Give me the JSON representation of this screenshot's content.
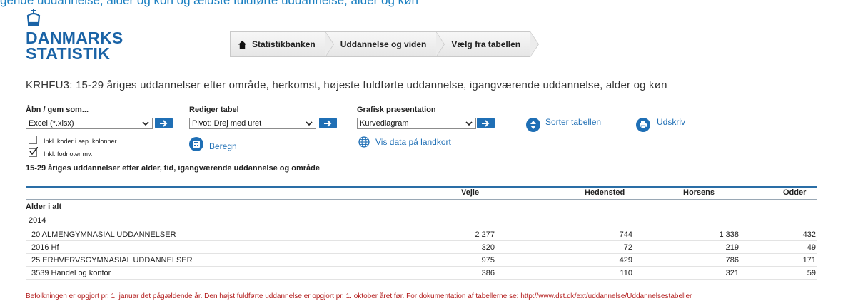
{
  "top_cut_text": "gende uddannelse, alder og kon og ældste fuldførte uddannelse, alder og køn",
  "logo": {
    "line1": "DANMARKS",
    "line2": "STATISTIK"
  },
  "breadcrumb": [
    "Statistikbanken",
    "Uddannelse og viden",
    "Vælg fra tabellen"
  ],
  "table_title": "KRHFU3: 15-29 åriges uddannelser efter område, herkomst, højeste fuldførte uddannelse, igangværende uddannelse, alder og køn",
  "open_save": {
    "label": "Åbn / gem som...",
    "selected": "Excel (*.xlsx)",
    "options": [
      {
        "label": "Inkl. koder i sep. kolonner",
        "checked": false
      },
      {
        "label": "Inkl. fodnoter mv.",
        "checked": true
      }
    ]
  },
  "edit_table": {
    "label": "Rediger tabel",
    "selected": "Pivot: Drej med uret",
    "calc_label": "Beregn"
  },
  "graphics": {
    "label": "Grafisk præsentation",
    "selected": "Kurvediagram",
    "map_label": "Vis data på landkort"
  },
  "sort_label": "Sorter tabellen",
  "print_label": "Udskriv",
  "data_table": {
    "caption": "15-29 åriges uddannelser efter alder, tid, igangværende uddannelse og område",
    "columns": [
      "Vejle",
      "Hedensted",
      "Horsens",
      "Odder"
    ],
    "group": "Alder i alt",
    "year": "2014",
    "rows": [
      {
        "label": "20 ALMENGYMNASIAL UDDANNELSER",
        "values": [
          "2 277",
          "744",
          "1 338",
          "432"
        ]
      },
      {
        "label": "2016 Hf",
        "values": [
          "320",
          "72",
          "219",
          "49"
        ]
      },
      {
        "label": "25 ERHVERVSGYMNASIAL UDDANNELSER",
        "values": [
          "975",
          "429",
          "786",
          "171"
        ]
      },
      {
        "label": "3539 Handel og kontor",
        "values": [
          "386",
          "110",
          "321",
          "59"
        ]
      }
    ]
  },
  "footnote": "Befolkningen er opgjort pr. 1. januar det pågældende år. Den højst fuldførte uddannelse er opgjort pr. 1. oktober året før. For dokumentation af tabellerne se: http://www.dst.dk/ext/uddannelse/Uddannelsestabeller",
  "colors": {
    "brand_blue": "#1a63a6",
    "link_blue": "#1f6fb5",
    "footnote_red": "#b21a1a"
  }
}
